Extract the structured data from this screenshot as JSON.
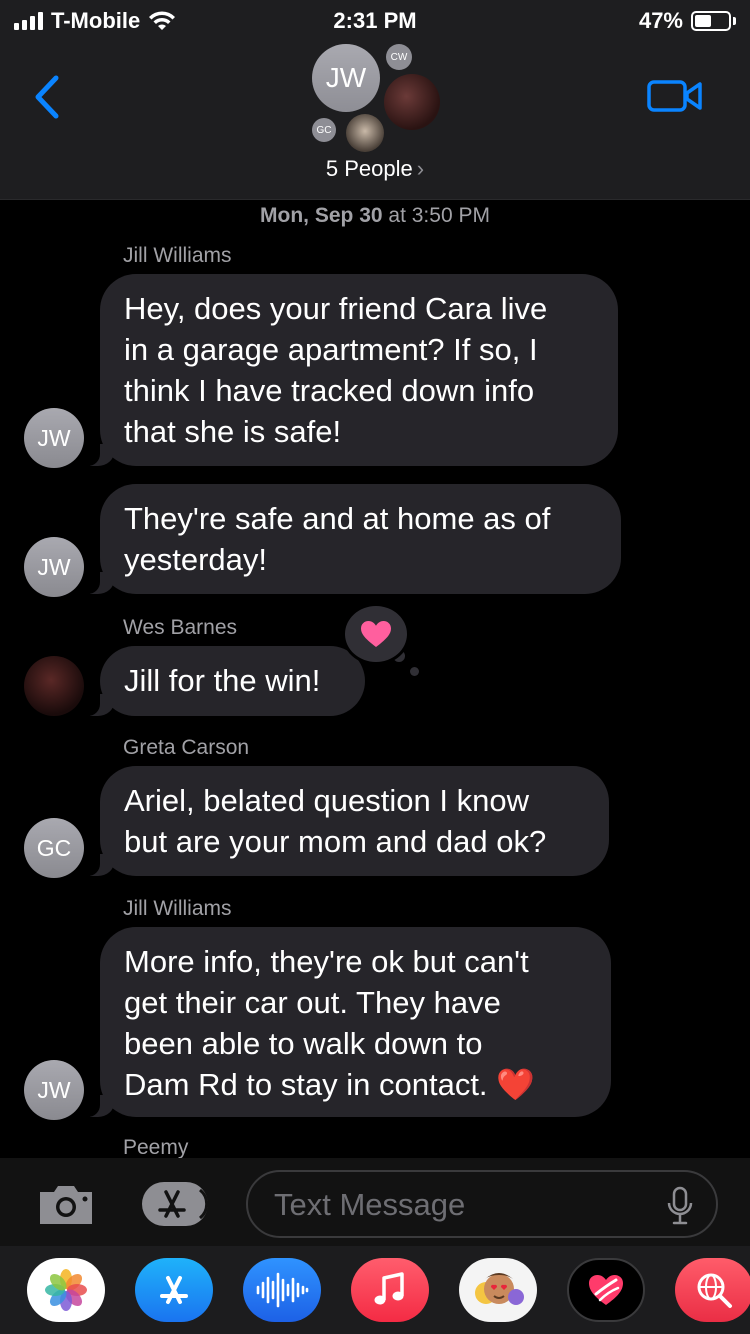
{
  "status_bar": {
    "carrier": "T-Mobile",
    "time": "2:31 PM",
    "battery": "47%"
  },
  "header": {
    "main_avatar_initials": "JW",
    "small_avatar_1": "CW",
    "small_avatar_2": "GC",
    "people_label": "5 People",
    "people_chevron": "›"
  },
  "conversation": {
    "date_day": "Mon, Sep 30",
    "date_time": " at 3:50 PM",
    "messages": [
      {
        "sender": "Jill Williams",
        "avatar": "JW",
        "lines": [
          "Hey, does your friend Cara live",
          "in a garage apartment? If so, I",
          "think I have tracked down info",
          "that she is safe!"
        ]
      },
      {
        "sender": "",
        "avatar": "JW",
        "lines": [
          "They're safe and at home as of",
          "yesterday!"
        ]
      },
      {
        "sender": "Wes Barnes",
        "avatar": "",
        "lines": [
          "Jill for the win!"
        ],
        "tapback": "heart"
      },
      {
        "sender": "Greta Carson",
        "avatar": "GC",
        "lines": [
          "Ariel, belated question I know",
          "but are your mom and dad ok?"
        ]
      },
      {
        "sender": "Jill Williams",
        "avatar": "JW",
        "lines": [
          "More info, they're ok but can't",
          "get their car out. They have",
          "been able to walk down to",
          "Dam Rd to stay in contact."
        ],
        "emoji": "❤️"
      }
    ],
    "next_sender": "Peemy"
  },
  "composer": {
    "placeholder": "Text Message"
  },
  "app_drawer": [
    "photos-app",
    "app-store-app",
    "audio-message-app",
    "music-app",
    "memoji-app",
    "digital-touch-app",
    "search-app"
  ],
  "colors": {
    "accent": "#0a84ff",
    "bubble": "#26252a",
    "tapback_heart": "#ff5f9e"
  }
}
